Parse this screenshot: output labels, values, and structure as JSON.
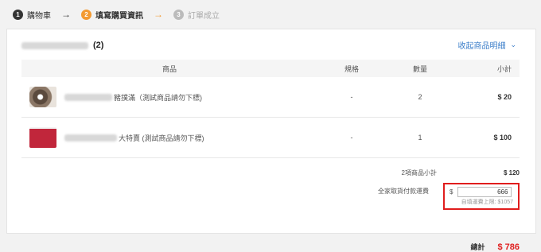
{
  "steps": [
    {
      "num": "1",
      "label": "購物車"
    },
    {
      "num": "2",
      "label": "填寫購買資訊"
    },
    {
      "num": "3",
      "label": "訂單成立"
    }
  ],
  "store": {
    "count": "(2)"
  },
  "collapse_label": "收起商品明細",
  "table": {
    "headers": {
      "name": "商品",
      "spec": "規格",
      "qty": "數量",
      "subtotal": "小計"
    },
    "rows": [
      {
        "name": "豬撲滿（測試商品請勿下標)",
        "spec": "-",
        "qty": "2",
        "subtotal": "$ 20"
      },
      {
        "name": "大特賣 (測試商品請勿下標)",
        "spec": "-",
        "qty": "1",
        "subtotal": "$ 100"
      }
    ]
  },
  "totals": {
    "items_label": "2項商品小計",
    "items_value": "$ 120",
    "shipping_label": "全家取貨付款運費",
    "currency": "$",
    "shipping_value": "666",
    "shipping_hint": "自填運費上限: $1057",
    "grand_label": "總計",
    "grand_value": "$ 786"
  },
  "colors": {
    "accent": "#f39a32",
    "link": "#3a7dc9",
    "highlight": "#e01d1d",
    "total": "#e02020"
  }
}
